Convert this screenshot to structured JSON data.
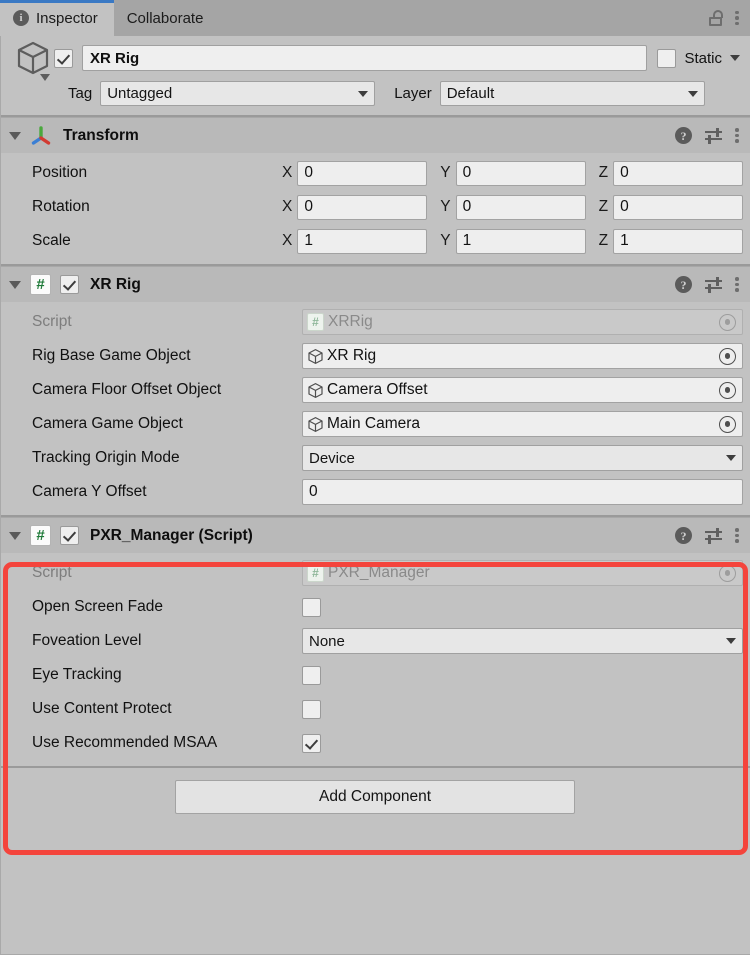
{
  "window": {
    "tabs": [
      {
        "label": "Inspector",
        "icon": "info-icon",
        "active": true
      },
      {
        "label": "Collaborate",
        "icon": "",
        "active": false
      }
    ],
    "lock_icon": "unlocked-padlock-icon",
    "menu_icon": "kebab-menu-icon"
  },
  "object_header": {
    "icon": "gameobject-cube-icon",
    "enabled": true,
    "name": "XR Rig",
    "static_label": "Static",
    "static_checked": false,
    "tag_label": "Tag",
    "tag_value": "Untagged",
    "layer_label": "Layer",
    "layer_value": "Default"
  },
  "components": [
    {
      "id": "transform",
      "title": "Transform",
      "icon": "transform-gizmo-icon",
      "expanded": true,
      "has_enable_checkbox": false,
      "rows": [
        {
          "type": "vector3",
          "label": "Position",
          "x": "0",
          "y": "0",
          "z": "0"
        },
        {
          "type": "vector3",
          "label": "Rotation",
          "x": "0",
          "y": "0",
          "z": "0"
        },
        {
          "type": "vector3",
          "label": "Scale",
          "x": "1",
          "y": "1",
          "z": "1"
        }
      ]
    },
    {
      "id": "xr-rig",
      "title": "XR Rig",
      "icon": "csharp-script-icon",
      "expanded": true,
      "has_enable_checkbox": true,
      "enabled": true,
      "rows": [
        {
          "type": "script",
          "label": "Script",
          "value": "XRRig"
        },
        {
          "type": "object",
          "label": "Rig Base Game Object",
          "value": "XR Rig"
        },
        {
          "type": "object",
          "label": "Camera Floor Offset Object",
          "value": "Camera Offset"
        },
        {
          "type": "object",
          "label": "Camera Game Object",
          "value": "Main Camera"
        },
        {
          "type": "enum",
          "label": "Tracking Origin Mode",
          "value": "Device"
        },
        {
          "type": "text",
          "label": "Camera Y Offset",
          "value": "0"
        }
      ]
    },
    {
      "id": "pxr-manager",
      "title": "PXR_Manager (Script)",
      "icon": "csharp-script-icon",
      "expanded": true,
      "has_enable_checkbox": true,
      "enabled": true,
      "highlighted": true,
      "rows": [
        {
          "type": "script",
          "label": "Script",
          "value": "PXR_Manager"
        },
        {
          "type": "checkbox",
          "label": "Open Screen Fade",
          "checked": false
        },
        {
          "type": "enum",
          "label": "Foveation Level",
          "value": "None"
        },
        {
          "type": "checkbox",
          "label": "Eye Tracking",
          "checked": false
        },
        {
          "type": "checkbox",
          "label": "Use Content Protect",
          "checked": false
        },
        {
          "type": "checkbox",
          "label": "Use Recommended MSAA",
          "checked": true
        }
      ]
    }
  ],
  "add_component": {
    "label": "Add Component"
  },
  "colors": {
    "panel_bg": "#c2c2c2",
    "tabbar_bg": "#a5a5a5",
    "component_header_bg": "#b9b9b9",
    "field_bg": "#eeeeee",
    "accent_tab": "#3a79c4",
    "highlight_red": "#f4443c",
    "script_green": "#1e7a38"
  }
}
